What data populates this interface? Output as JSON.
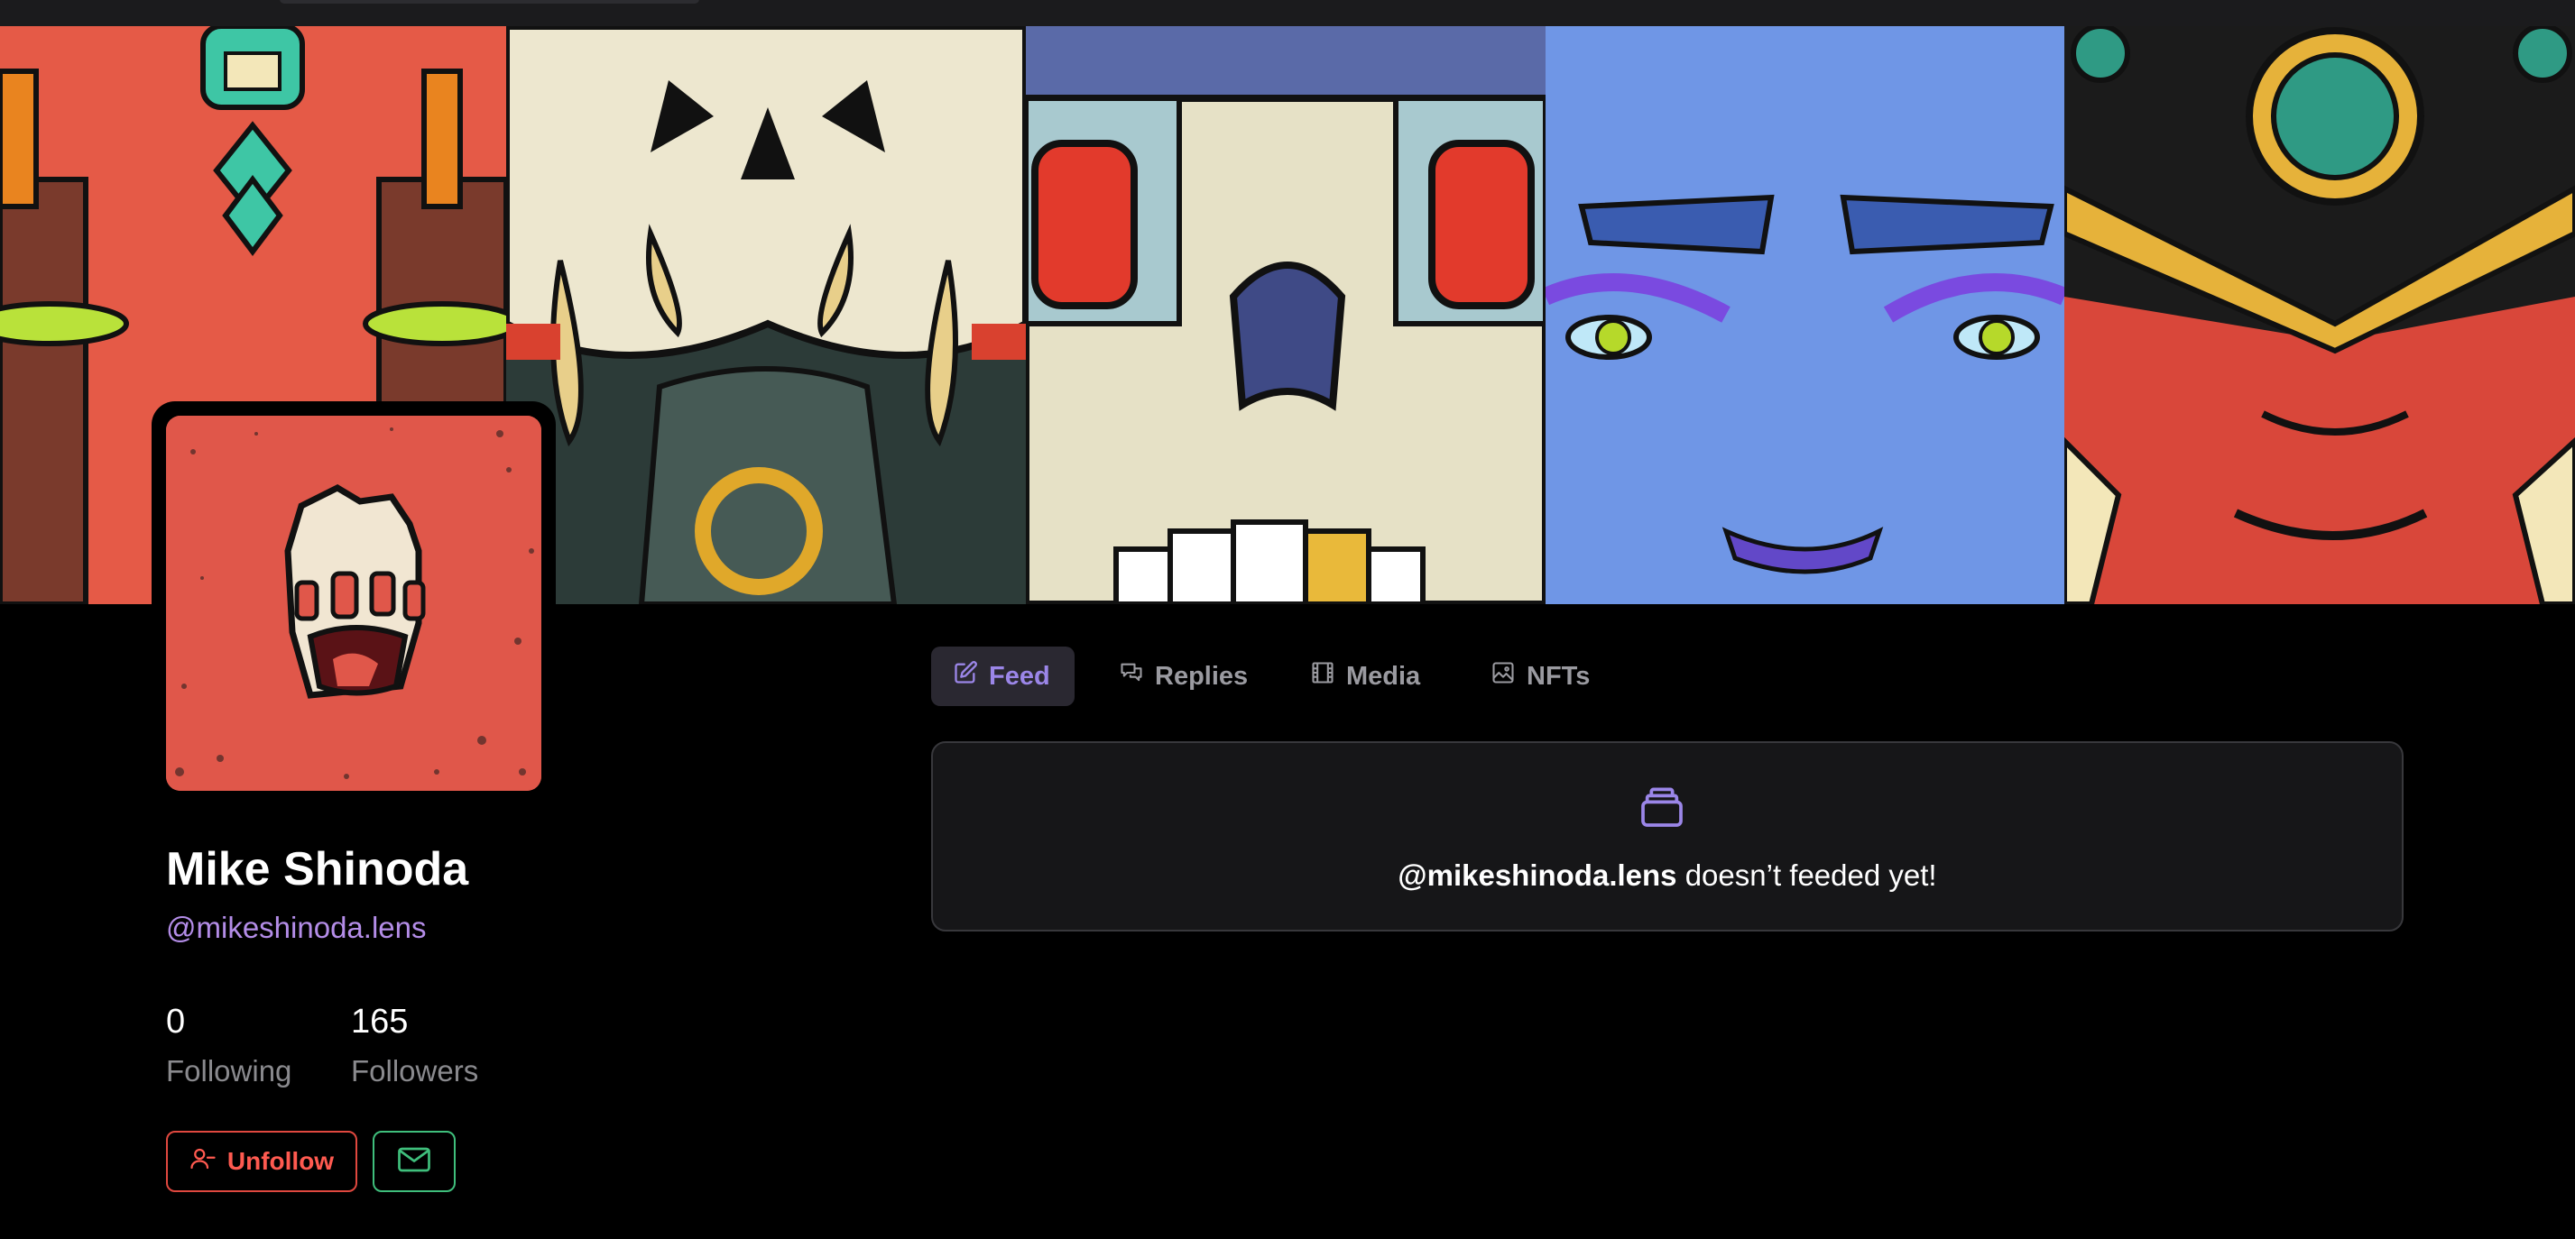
{
  "profile": {
    "name": "Mike Shinoda",
    "handle": "@mikeshinoda.lens",
    "following_count": "0",
    "following_label": "Following",
    "followers_count": "165",
    "followers_label": "Followers",
    "unfollow_label": "Unfollow"
  },
  "tabs": [
    {
      "label": "Feed",
      "icon": "pencil-square-icon",
      "active": true
    },
    {
      "label": "Replies",
      "icon": "chat-bubbles-icon",
      "active": false
    },
    {
      "label": "Media",
      "icon": "film-icon",
      "active": false
    },
    {
      "label": "NFTs",
      "icon": "photo-icon",
      "active": false
    }
  ],
  "empty_state": {
    "handle": "@mikeshinoda.lens",
    "message": " doesn’t feeded yet!",
    "icon": "collection-icon"
  },
  "colors": {
    "accent": "#9b86e8",
    "handle": "#b48de8",
    "unfollow": "#ff5a50",
    "message": "#3fbf7c"
  }
}
